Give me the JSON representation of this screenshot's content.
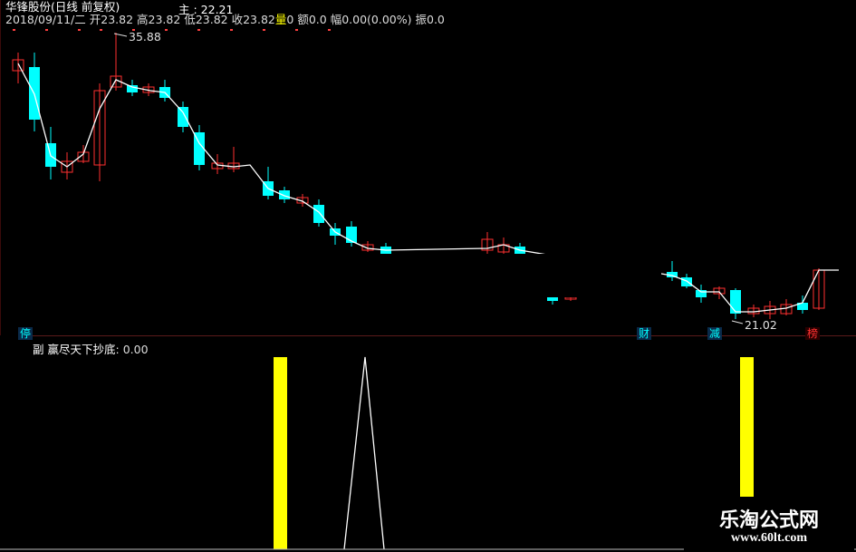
{
  "header": {
    "stock_title": "华锋股份(日线 前复权)",
    "main_indicator": "主 : 22.21",
    "ohlc_line": {
      "date": "2018/09/11/二",
      "open": "开23.82",
      "high": "高23.82",
      "low": "低23.82",
      "close": "收23.82",
      "vol_tag": "量",
      "vol": "0",
      "amount": "额0.0",
      "change": "幅0.00(0.00%)",
      "amplitude": "振0.0"
    }
  },
  "chart": {
    "high_marker": "35.88",
    "low_marker": "21.02",
    "badges": [
      "停",
      "财",
      "减",
      "榜"
    ],
    "colors": {
      "up": "#ff3030",
      "down": "#00ffff",
      "ma": "#ffffff",
      "signal": "#ffff00"
    }
  },
  "sub_panel": {
    "label_prefix": "副",
    "indicator_name": "赢尽天下抄底",
    "indicator_value": ": 0.00"
  },
  "watermark": {
    "line1": "乐淘公式网",
    "line2": "www.60lt.com"
  }
}
